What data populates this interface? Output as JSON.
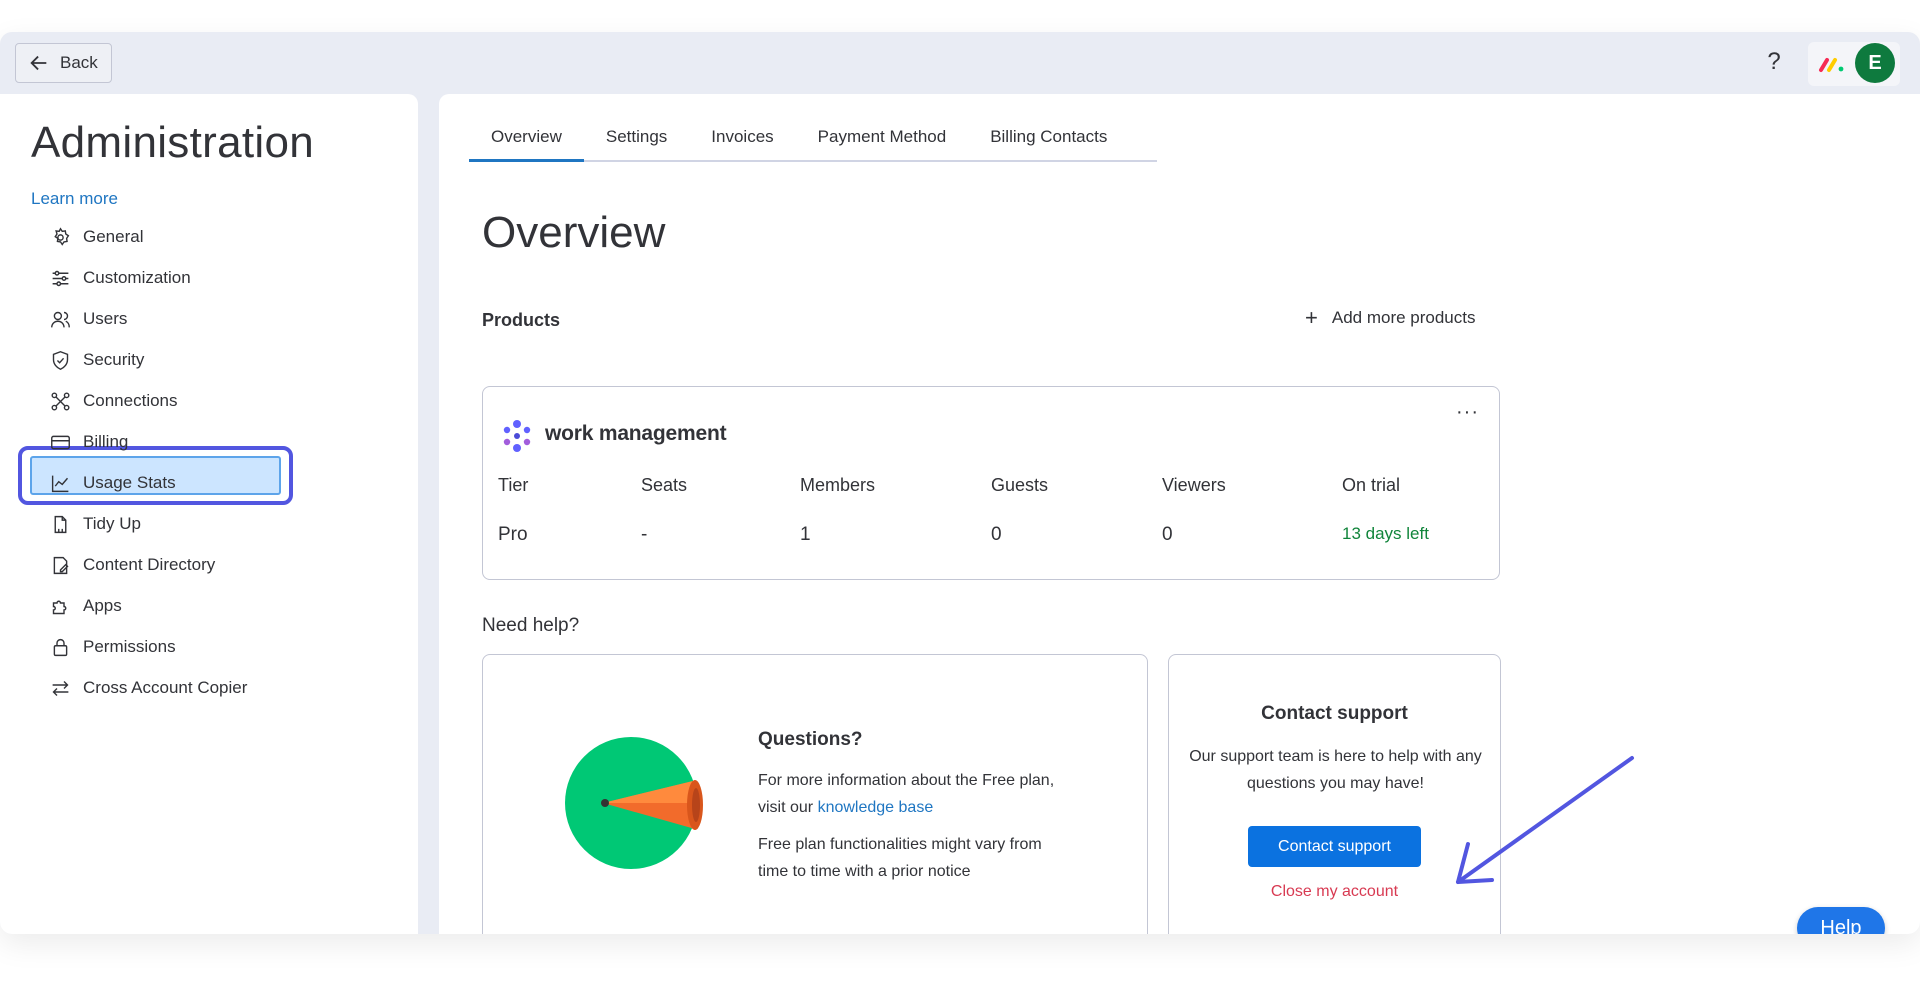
{
  "topbar": {
    "back_label": "Back",
    "help_symbol": "?",
    "avatar_initial": "E",
    "avatar_color": "#0e7a3e"
  },
  "sidebar": {
    "title": "Administration",
    "learn_more": "Learn more",
    "active_item": "Billing",
    "items": [
      {
        "label": "General",
        "icon": "gear-icon"
      },
      {
        "label": "Customization",
        "icon": "sliders-icon"
      },
      {
        "label": "Users",
        "icon": "users-icon"
      },
      {
        "label": "Security",
        "icon": "shield-icon"
      },
      {
        "label": "Connections",
        "icon": "connections-icon"
      },
      {
        "label": "Billing",
        "icon": "credit-card-icon"
      },
      {
        "label": "Usage Stats",
        "icon": "chart-icon"
      },
      {
        "label": "Tidy Up",
        "icon": "broom-icon"
      },
      {
        "label": "Content Directory",
        "icon": "document-icon"
      },
      {
        "label": "Apps",
        "icon": "puzzle-icon"
      },
      {
        "label": "Permissions",
        "icon": "lock-icon"
      },
      {
        "label": "Cross Account Copier",
        "icon": "arrows-swap-icon"
      }
    ]
  },
  "main": {
    "tabs": [
      {
        "label": "Overview",
        "active": true
      },
      {
        "label": "Settings"
      },
      {
        "label": "Invoices"
      },
      {
        "label": "Payment Method"
      },
      {
        "label": "Billing Contacts"
      }
    ],
    "title": "Overview",
    "products_label": "Products",
    "add_products": "Add more products",
    "product": {
      "name": "work management",
      "menu": "···",
      "headers": [
        "Tier",
        "Seats",
        "Members",
        "Guests",
        "Viewers",
        "On trial"
      ],
      "values": [
        "Pro",
        "-",
        "1",
        "0",
        "0",
        "13 days left"
      ]
    },
    "need_help": "Need help?",
    "questions": {
      "title": "Questions?",
      "text_before_link": "For more information about the Free plan, visit our ",
      "link": "knowledge base",
      "text2": "Free plan functionalities might vary from time to time with a prior notice"
    },
    "contact": {
      "title": "Contact support",
      "text": "Our support team is here to help with any questions you may have!",
      "button": "Contact support",
      "close": "Close my account"
    },
    "help_fab": "Help"
  },
  "colors": {
    "accent": "#1f76c2",
    "primary_button": "#0b72e0",
    "danger": "#d83a52",
    "trial_green": "#11853b",
    "highlight_outline": "#5256e0"
  }
}
